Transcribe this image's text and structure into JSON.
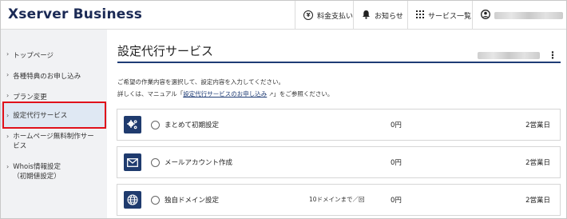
{
  "header": {
    "logo": "Xserver Business",
    "payment_label": "料金支払い",
    "payment_icon": "yen-icon",
    "notice_label": "お知らせ",
    "notice_icon": "bell-icon",
    "services_label": "サービス一覧",
    "services_icon": "grid-icon",
    "account_icon": "user-icon"
  },
  "sidebar": {
    "items": [
      {
        "label": "トップページ"
      },
      {
        "label": "各種特典のお申し込み"
      },
      {
        "label": "プラン変更"
      },
      {
        "label": "設定代行サービス"
      },
      {
        "label": "ホームページ無料制作サービス"
      },
      {
        "label": "Whois情報設定",
        "sub": "（初期値設定）"
      }
    ],
    "active_index": 3,
    "highlight_color": "#e0111b"
  },
  "main": {
    "title": "設定代行サービス",
    "intro_line1": "ご希望の作業内容を選択して、設定内容を入力してください。",
    "intro_line2_prefix": "詳しくは、マニュアル「",
    "intro_link": "設定代行サービスのお申し込み",
    "intro_line2_suffix": "」をご参照ください。",
    "services": [
      {
        "name": "まとめて初期設定",
        "note": "",
        "price": "0円",
        "days": "2営業日",
        "icon": "gears-icon"
      },
      {
        "name": "メールアカウント作成",
        "note": "",
        "price": "0円",
        "days": "2営業日",
        "icon": "mail-icon"
      },
      {
        "name": "独自ドメイン設定",
        "note": "10ドメインまで／回",
        "price": "0円",
        "days": "2営業日",
        "icon": "globe-icon"
      }
    ]
  },
  "colors": {
    "brand_navy": "#1b2a55",
    "icon_bg": "#1f3b6e",
    "sidebar_bg": "#f1f2f4",
    "active_bg": "#dfe8f3"
  }
}
